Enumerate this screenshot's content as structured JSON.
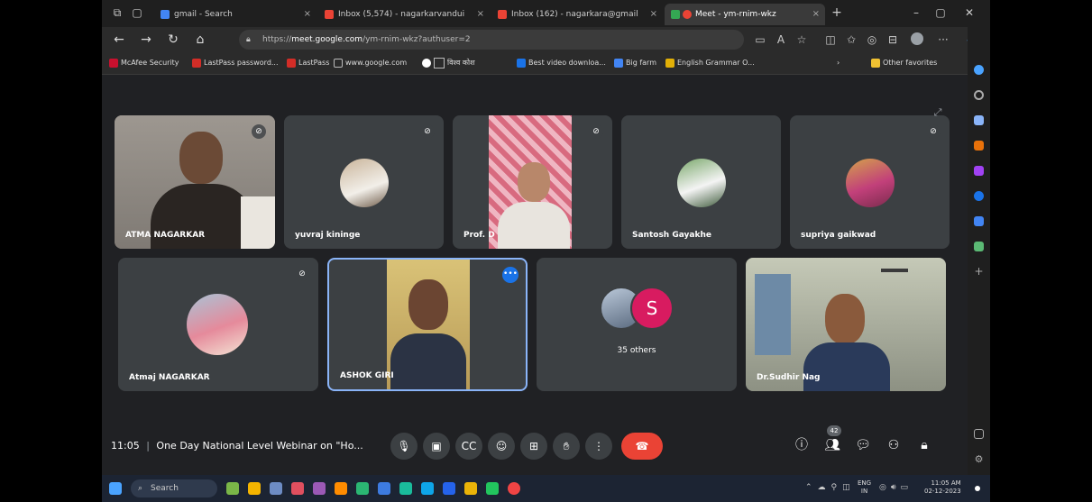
{
  "browser": {
    "tabs": [
      {
        "title": "gmail - Search",
        "close": "×"
      },
      {
        "title": "Inbox (5,574) - nagarkarvandui",
        "close": "×"
      },
      {
        "title": "Inbox (162) - nagarkara@gmail",
        "close": "×"
      },
      {
        "title": "Meet - ym-rnim-wkz",
        "close": "×"
      }
    ],
    "new_tab": "+",
    "url_prefix": "https://",
    "url_host": "meet.google.com",
    "url_path": "/ym-rnim-wkz?authuser=2",
    "bookmarks": [
      "McAfee Security",
      "LastPass password...",
      "LastPass",
      "www.google.com",
      "विश्व कोश",
      "Best video downloa...",
      "Big farm",
      "English Grammar O..."
    ],
    "bookmarks_more": "Other favorites"
  },
  "tiles": [
    {
      "name": "ATMA NAGARKAR"
    },
    {
      "name": "yuvraj kininge"
    },
    {
      "name": "Prof. D"
    },
    {
      "name": "Santosh Gayakhe"
    },
    {
      "name": "supriya gaikwad"
    },
    {
      "name": "Atmaj NAGARKAR"
    },
    {
      "name": "ASHOK GIRI"
    },
    {
      "name": "35 others",
      "initial": "S"
    },
    {
      "name": "Dr.Sudhir Nag"
    }
  ],
  "meeting": {
    "time": "11:05",
    "separator": "|",
    "title": "One Day National Level Webinar on \"Ho...",
    "participants_badge": "42"
  },
  "taskbar": {
    "search_label": "Search",
    "lang_top": "ENG",
    "lang_bottom": "IN",
    "clock_time": "11:05 AM",
    "clock_date": "02-12-2023"
  },
  "colors": {
    "meet_bg": "#202124",
    "tile_bg": "#3c4043",
    "leave_red": "#ea4335",
    "active_border": "#8ab4f8",
    "avatar_pink": "#d81b60"
  }
}
